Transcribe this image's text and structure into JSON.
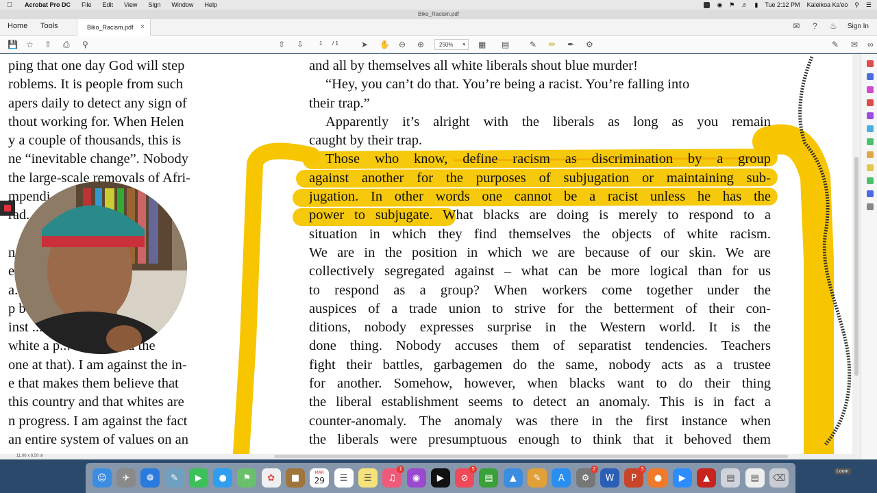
{
  "menubar": {
    "app_name": "Acrobat Pro DC",
    "items": [
      "File",
      "Edit",
      "View",
      "Sign",
      "Window",
      "Help"
    ],
    "window_title": "Biko_Racism.pdf",
    "time": "Tue 2:12 PM",
    "user": "Kaleikoa Ka'eo"
  },
  "tabs": {
    "home": "Home",
    "tools": "Tools",
    "document": "Biko_Racism.pdf",
    "close": "×",
    "signin": "Sign In"
  },
  "toolbar": {
    "page_current": "1",
    "page_total": "/ 1",
    "zoom": "250%"
  },
  "document": {
    "left_column": [
      "ping that one day God will step",
      "roblems. It is people from such",
      "apers daily to detect any sign of",
      "thout working for. When Helen",
      "y a couple of thousands, this is",
      "ne “inevitable change”. Nobody",
      "the large-scale removals of Afri-",
      "mpendi... places like",
      "rad... ...ations of",
      "",
      "ni... ...n you",
      "ei... ...ssimi-",
      "a... ...set of",
      "p b... ...whites,",
      "inst ... ...or white-",
      "white a p... teacherand the",
      "one at that). I am against the in-",
      "e that makes them believe that",
      "this country and that whites are",
      "n progress. I am against the fact",
      "an entire system of values on an"
    ],
    "right_column": [
      "and all by themselves all white liberals shout blue murder!",
      "“Hey, you can’t do that. You’re being a racist. You’re falling into",
      "their trap.”",
      "Apparently it’s alright with the liberals as long as you remain",
      "caught by their trap.",
      "Those who know, define racism as discrimination by a group",
      "against another for the purposes of subjugation or maintaining sub-",
      "jugation. In other words one cannot be a racist unless he has the",
      "power to subjugate. What blacks are doing is merely to respond to a",
      "situation in which they find themselves the objects of white racism.",
      "We are in the position in which we are because of our skin. We are",
      "collectively segregated against – what can be more logical than for us",
      "to respond as a group? When workers come together under the",
      "auspices of a trade union to strive for the betterment of their con-",
      "ditions, nobody expresses surprise in the Western world. It is the",
      "done thing. Nobody accuses them of separatist tendencies. Teachers",
      "fight their battles, garbagemen do the same, nobody acts as a trustee",
      "for another. Somehow, however, when blacks want to do their thing",
      "the liberal establishment seems to detect an anomaly. This is in fact a",
      "counter-anomaly. The anomaly was there in the first instance when",
      "the liberals were presumptuous enough to think that it behoved them"
    ],
    "page_size": "11.00 x 8.50 in"
  },
  "dock": {
    "calendar_month": "MAR",
    "calendar_day": "29",
    "badges": {
      "music": "1",
      "news": "5",
      "sysprefs": "2",
      "powerpoint": "5"
    },
    "loom_label": "Loom"
  },
  "colors": {
    "highlight": "#f7c600",
    "highlight_orange": "#f0a400",
    "menubar": "#e8e8e8"
  }
}
